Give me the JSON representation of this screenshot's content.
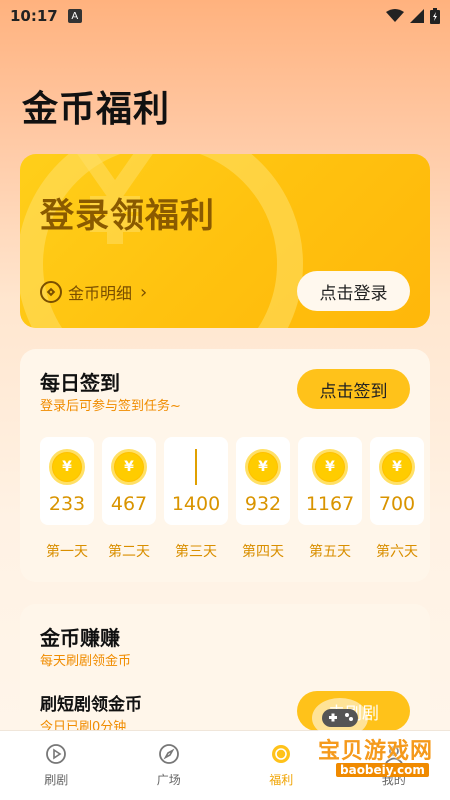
{
  "status": {
    "time": "10:17",
    "notif_letter": "A"
  },
  "page": {
    "title": "金币福利"
  },
  "login_card": {
    "title": "登录领福利",
    "coin_detail_label": "金币明细",
    "login_button": "点击登录"
  },
  "signin": {
    "title": "每日签到",
    "subtitle": "登录后可参与签到任务~",
    "button": "点击签到",
    "days": [
      {
        "amount": "233",
        "label": "第一天"
      },
      {
        "amount": "467",
        "label": "第二天"
      },
      {
        "amount": "1400",
        "label": "第三天"
      },
      {
        "amount": "932",
        "label": "第四天"
      },
      {
        "amount": "1167",
        "label": "第五天"
      },
      {
        "amount": "700",
        "label": "第六天"
      }
    ],
    "coin_symbol": "¥"
  },
  "earn": {
    "title": "金币赚赚",
    "subtitle": "每天刷剧领金币",
    "task_title": "刷短剧领金币",
    "task_sub": "今日已刷0分钟",
    "task_button": "去刷剧"
  },
  "nav": {
    "items": [
      {
        "label": "刷剧",
        "icon": "play-circle-icon",
        "active": false
      },
      {
        "label": "广场",
        "icon": "compass-icon",
        "active": false
      },
      {
        "label": "福利",
        "icon": "coin-icon",
        "active": true
      },
      {
        "label": "我的",
        "icon": "user-icon",
        "active": false
      }
    ]
  },
  "watermark": {
    "text": "宝贝游戏网",
    "url": "baobeiy.com"
  },
  "colors": {
    "accent": "#ffc21a",
    "accent_text": "#f08c00",
    "coin": "#ffcc00"
  }
}
